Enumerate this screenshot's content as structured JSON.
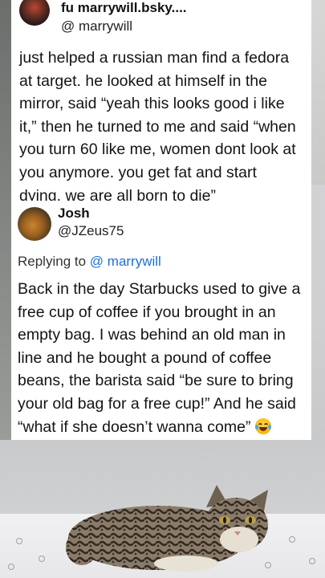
{
  "original_tweet": {
    "name": "fu   marrywill.bsky....",
    "handle": "@      marrywill",
    "text": "just helped a russian man find a fedora at target. he looked at himself in the mirror, said “yeah this looks good i like it,” then he turned to me and said “when you turn 60 like me, women dont look at you anymore. you get fat and start dying. we are all born to die”"
  },
  "reply_tweet": {
    "name": "Josh",
    "handle": "@JZeus75",
    "replying_prefix": "Replying to",
    "replying_mention": "@        marrywill",
    "text": "Back in the day Starbucks used to give a free cup of coffee if you brought in an empty bag. I was behind an old man in line and he bought a pound of coffee beans, the barista said “be sure to bring your old bag for a free cup!” And he said “what if she doesn’t wanna come”",
    "emoji": "laughing-with-tears-emoji"
  },
  "colors": {
    "mention": "#1d6fd6",
    "card": "#ffffff",
    "background": "#d6d6d8"
  }
}
